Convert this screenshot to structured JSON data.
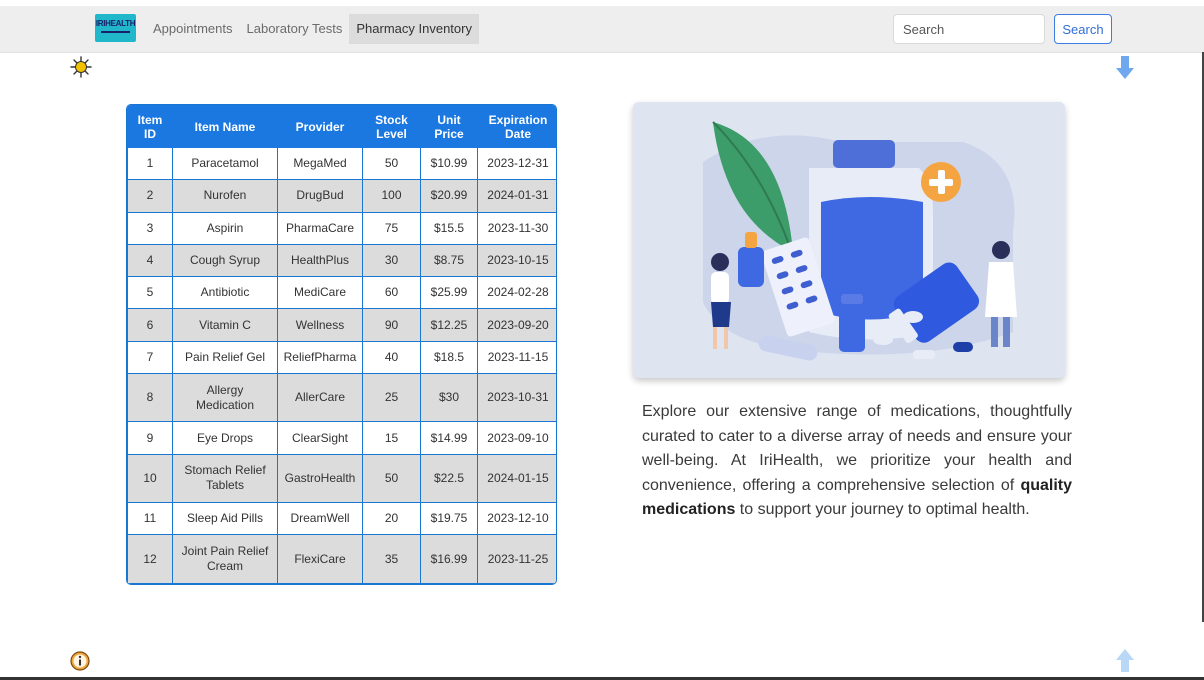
{
  "brand": {
    "logo_text": "IRIHEALTH"
  },
  "nav": {
    "items": [
      {
        "label": "Appointments"
      },
      {
        "label": "Laboratory Tests"
      },
      {
        "label": "Pharmacy Inventory"
      }
    ]
  },
  "search": {
    "placeholder": "Search",
    "button_label": "Search"
  },
  "table": {
    "headers": [
      "Item ID",
      "Item Name",
      "Provider",
      "Stock Level",
      "Unit Price",
      "Expiration Date"
    ],
    "rows": [
      [
        "1",
        "Paracetamol",
        "MegaMed",
        "50",
        "$10.99",
        "2023-12-31"
      ],
      [
        "2",
        "Nurofen",
        "DrugBud",
        "100",
        "$20.99",
        "2024-01-31"
      ],
      [
        "3",
        "Aspirin",
        "PharmaCare",
        "75",
        "$15.5",
        "2023-11-30"
      ],
      [
        "4",
        "Cough Syrup",
        "HealthPlus",
        "30",
        "$8.75",
        "2023-10-15"
      ],
      [
        "5",
        "Antibiotic",
        "MediCare",
        "60",
        "$25.99",
        "2024-02-28"
      ],
      [
        "6",
        "Vitamin C",
        "Wellness",
        "90",
        "$12.25",
        "2023-09-20"
      ],
      [
        "7",
        "Pain Relief Gel",
        "ReliefPharma",
        "40",
        "$18.5",
        "2023-11-15"
      ],
      [
        "8",
        "Allergy Medication",
        "AllerCare",
        "25",
        "$30",
        "2023-10-31"
      ],
      [
        "9",
        "Eye Drops",
        "ClearSight",
        "15",
        "$14.99",
        "2023-09-10"
      ],
      [
        "10",
        "Stomach Relief Tablets",
        "GastroHealth",
        "50",
        "$22.5",
        "2024-01-15"
      ],
      [
        "11",
        "Sleep Aid Pills",
        "DreamWell",
        "20",
        "$19.75",
        "2023-12-10"
      ],
      [
        "12",
        "Joint Pain Relief Cream",
        "FlexiCare",
        "35",
        "$16.99",
        "2023-11-25"
      ]
    ]
  },
  "description": {
    "part1": "Explore our extensive range of medications, thoughtfully curated to cater to a diverse array of needs and ensure your well-being. At IriHealth, we prioritize your health and convenience, offering a comprehensive selection of ",
    "bold": "quality medications",
    "part2": " to support your journey to optimal health."
  },
  "colors": {
    "accent": "#1a78e0",
    "row_alt": "#dcdcdc",
    "logo_bg": "#1fb7c9",
    "illustration_bg": "#dfe4f1"
  },
  "icons": {
    "top_left": "bug-icon",
    "top_right": "arrow-down-icon",
    "bottom_left": "info-icon",
    "bottom_right": "arrow-up-icon"
  }
}
